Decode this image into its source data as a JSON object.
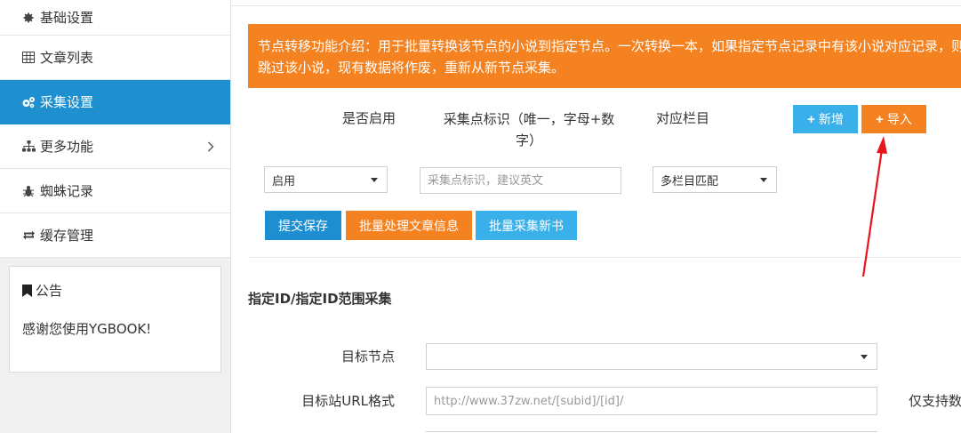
{
  "sidebar": {
    "items": [
      {
        "label": "基础设置",
        "icon": "gear-icon"
      },
      {
        "label": "文章列表",
        "icon": "table-icon"
      },
      {
        "label": "采集设置",
        "icon": "gears-icon"
      },
      {
        "label": "更多功能",
        "icon": "sitemap-icon"
      },
      {
        "label": "蜘蛛记录",
        "icon": "bug-icon"
      },
      {
        "label": "缓存管理",
        "icon": "refresh-icon"
      }
    ],
    "active_index": 2
  },
  "notice": {
    "title": "公告",
    "icon": "bookmark-icon",
    "body": "感谢您使用YGBOOK!"
  },
  "banner": {
    "text": "节点转移功能介绍：用于批量转换该节点的小说到指定节点。一次转换一本，如果指定节点记录中有该小说对应记录，则跳过该小说，现有数据将作废，重新从新节点采集。"
  },
  "collect": {
    "col_enable": "是否启用",
    "col_id": "采集点标识（唯一，字母+数字）",
    "col_category": "对应栏目",
    "add_label": "新增",
    "import_label": "导入",
    "enable_value": "启用",
    "id_placeholder": "采集点标识，建议英文",
    "category_value": "多栏目匹配",
    "submit_label": "提交保存",
    "batch_article_label": "批量处理文章信息",
    "batch_new_label": "批量采集新书"
  },
  "range": {
    "title": "指定ID/指定ID范围采集",
    "target_node_label": "目标节点",
    "target_node_value": "",
    "url_format_label": "目标站URL格式",
    "url_format_placeholder": "http://www.37zw.net/[subid]/[id]/",
    "url_hint": "仅支持数"
  },
  "colors": {
    "accent_blue": "#1e90d0",
    "orange": "#f58220",
    "light_blue": "#3ab0ea",
    "arrow_red": "#e8141c"
  }
}
